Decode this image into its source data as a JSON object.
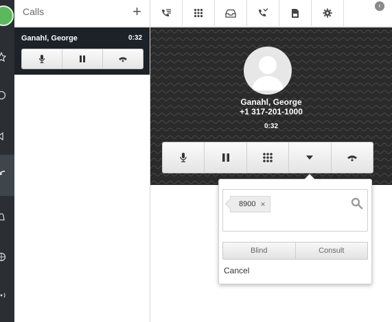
{
  "calls_panel": {
    "title": "Calls",
    "add_label": "+",
    "active_call": {
      "name": "Ganahl, George",
      "duration": "0:32"
    }
  },
  "toolbar": {
    "icons": [
      "call-log-icon",
      "dialpad-icon",
      "inbox-icon",
      "missed-call-icon",
      "voicemail-icon",
      "settings-icon"
    ],
    "collapse_glyph": "‹"
  },
  "call": {
    "name": "Ganahl, George",
    "number": "+1 317-201-1000",
    "duration": "0:32",
    "controls": [
      "mute",
      "hold",
      "dialpad",
      "more",
      "hangup"
    ]
  },
  "transfer": {
    "chip": "8900",
    "chip_remove": "×",
    "blind_label": "Blind",
    "consult_label": "Consult",
    "cancel_label": "Cancel"
  },
  "colors": {
    "rail": "#2b2f33",
    "active_call_bg": "#1c2227",
    "stage_bg": "#2a2a2a",
    "presence": "#5cb85c"
  }
}
